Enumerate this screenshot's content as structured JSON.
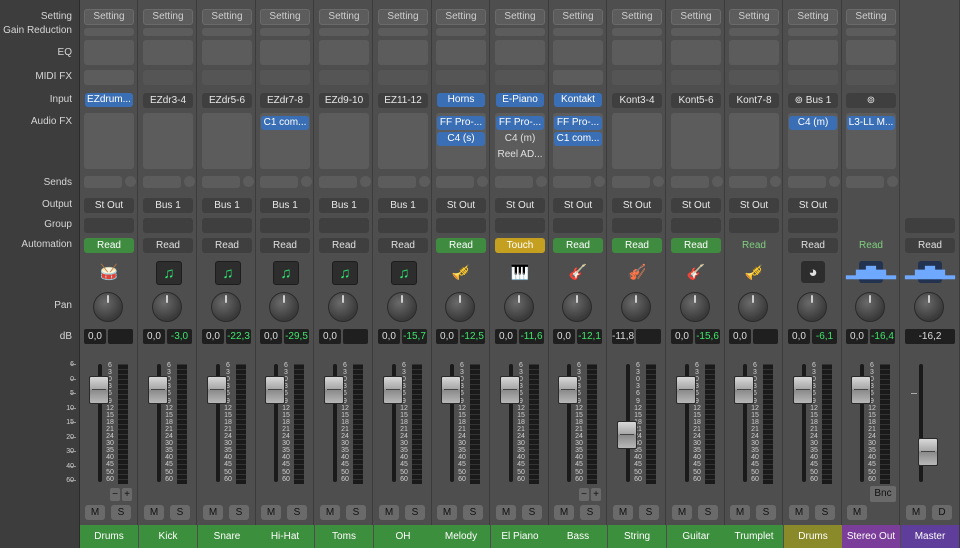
{
  "rows": {
    "setting": "Setting",
    "gain_reduction": "Gain Reduction",
    "eq": "EQ",
    "midi_fx": "MIDI FX",
    "input": "Input",
    "audio_fx": "Audio FX",
    "sends": "Sends",
    "output": "Output",
    "group": "Group",
    "automation": "Automation",
    "pan": "Pan",
    "db": "dB"
  },
  "setting_label": "Setting",
  "mute_label": "M",
  "solo_label": "S",
  "dim_label": "D",
  "minus_label": "−",
  "plus_label": "+",
  "bounce_label": "Bnc",
  "scale_ticks": [
    "6",
    "3",
    "0",
    "3",
    "6",
    "9",
    "12",
    "15",
    "18",
    "21",
    "24",
    "30",
    "35",
    "40",
    "45",
    "50",
    "60"
  ],
  "left_scale_ticks": [
    "6",
    "0",
    "5",
    "10",
    "15",
    "20",
    "30",
    "40",
    "60"
  ],
  "colors": {
    "plugin_blue": "#3a6fb6",
    "automation_read": "#3f8b3f",
    "automation_touch": "#c5a020",
    "peak_green": "#3de86a",
    "name_green": "#3c8f3c",
    "name_yellow": "#8a8a2a",
    "name_purple": "#7a3d9a"
  },
  "channels": [
    {
      "name": "Drums",
      "color": "green",
      "input": "EZdrum...",
      "input_hl": true,
      "fx": [],
      "output": "St Out",
      "automation": "Read",
      "auto_style": "read",
      "icon": "drum-kit-icon",
      "icon_glyph": "🥁",
      "icon_style": "plain",
      "pan": "0,0",
      "peak": "",
      "fader_db": 0,
      "plusminus": true
    },
    {
      "name": "Kick",
      "color": "green",
      "input": "EZdr3-4",
      "input_hl": false,
      "fx": [],
      "output": "Bus 1",
      "automation": "Read",
      "auto_style": "master",
      "icon": "midi-note-icon",
      "icon_glyph": "♫",
      "icon_style": "note",
      "pan": "0,0",
      "peak": "-3,0",
      "fader_db": 0
    },
    {
      "name": "Snare",
      "color": "green",
      "input": "EZdr5-6",
      "input_hl": false,
      "fx": [],
      "output": "Bus 1",
      "automation": "Read",
      "auto_style": "master",
      "icon": "midi-note-icon",
      "icon_glyph": "♫",
      "icon_style": "note",
      "pan": "0,0",
      "peak": "-22,3",
      "fader_db": 0
    },
    {
      "name": "Hi-Hat",
      "color": "green",
      "input": "EZdr7-8",
      "input_hl": false,
      "fx": [
        "C1 com..."
      ],
      "output": "Bus 1",
      "automation": "Read",
      "auto_style": "master",
      "icon": "midi-note-icon",
      "icon_glyph": "♫",
      "icon_style": "note",
      "pan": "0,0",
      "peak": "-29,5",
      "fader_db": 0
    },
    {
      "name": "Toms",
      "color": "green",
      "input": "EZd9-10",
      "input_hl": false,
      "fx": [],
      "output": "Bus 1",
      "automation": "Read",
      "auto_style": "master",
      "icon": "midi-note-icon",
      "icon_glyph": "♫",
      "icon_style": "note",
      "pan": "0,0",
      "peak": "",
      "fader_db": 0
    },
    {
      "name": "OH",
      "color": "green",
      "input": "EZ11-12",
      "input_hl": false,
      "fx": [],
      "output": "Bus 1",
      "automation": "Read",
      "auto_style": "master",
      "icon": "midi-note-icon",
      "icon_glyph": "♫",
      "icon_style": "note",
      "pan": "0,0",
      "peak": "-15,7",
      "fader_db": 0
    },
    {
      "name": "Melody",
      "color": "green",
      "input": "Horns",
      "input_hl": true,
      "fx": [
        "FF Pro-...",
        "C4 (s)"
      ],
      "output": "St Out",
      "automation": "Read",
      "auto_style": "read",
      "icon": "horns-icon",
      "icon_glyph": "🎺",
      "icon_style": "plain",
      "pan": "0,0",
      "peak": "-12,5",
      "fader_db": 0
    },
    {
      "name": "El Piano",
      "color": "green",
      "input": "E-Piano",
      "input_hl": true,
      "fx": [
        "FF Pro-...",
        "C4 (m)",
        "Reel AD..."
      ],
      "fx_plain": [
        false,
        true,
        true
      ],
      "output": "St Out",
      "automation": "Touch",
      "auto_style": "touch",
      "icon": "piano-icon",
      "icon_glyph": "🎹",
      "icon_style": "plain",
      "pan": "0,0",
      "peak": "-11,6",
      "fader_db": 0
    },
    {
      "name": "Bass",
      "color": "green",
      "input": "Kontakt",
      "input_hl": true,
      "fx": [
        "FF Pro-...",
        "C1 com..."
      ],
      "output": "St Out",
      "automation": "Read",
      "auto_style": "read",
      "icon": "bass-guitar-icon",
      "icon_glyph": "🎸",
      "icon_style": "plain",
      "pan": "0,0",
      "peak": "-12,1",
      "fader_db": 0,
      "plusminus": true
    },
    {
      "name": "String",
      "color": "green",
      "input": "Kont3-4",
      "input_hl": false,
      "fx": [],
      "output": "St Out",
      "automation": "Read",
      "auto_style": "read",
      "icon": "strings-icon",
      "icon_glyph": "🎻",
      "icon_style": "plain",
      "pan": "-11,8",
      "peak": "",
      "fader_db": -11.8,
      "wide_db": false
    },
    {
      "name": "Guitar",
      "color": "green",
      "input": "Kont5-6",
      "input_hl": false,
      "fx": [],
      "output": "St Out",
      "automation": "Read",
      "auto_style": "read",
      "icon": "acoustic-guitar-icon",
      "icon_glyph": "🎸",
      "icon_style": "plain",
      "pan": "0,0",
      "peak": "-15,6",
      "fader_db": 0
    },
    {
      "name": "Trumplet",
      "color": "green",
      "input": "Kont7-8",
      "input_hl": false,
      "fx": [],
      "output": "St Out",
      "automation": "Read",
      "auto_style": "stereo",
      "icon": "trumpet-icon",
      "icon_glyph": "🎺",
      "icon_style": "plain",
      "pan": "0,0",
      "peak": "",
      "fader_db": 0
    },
    {
      "name": "Drums",
      "color": "yellow",
      "input": "Bus 1",
      "input_link": true,
      "input_hl": false,
      "fx": [
        "C4 (m)"
      ],
      "output": "St Out",
      "automation": "Read",
      "auto_style": "master",
      "icon": "aux-clock-icon",
      "icon_glyph": "◕",
      "icon_style": "clock",
      "pan": "0,0",
      "peak": "-6,1",
      "fader_db": 0
    },
    {
      "name": "Stereo Out",
      "color": "purple",
      "input": "",
      "input_link": true,
      "input_hl": false,
      "fx": [
        "L3-LL M..."
      ],
      "output": "",
      "automation": "Read",
      "auto_style": "stereo",
      "icon": "waveform-icon",
      "icon_glyph": "▂▅▇▅▂",
      "icon_style": "wave",
      "pan": "0,0",
      "peak": "-16,4",
      "fader_db": 0,
      "bounce": true,
      "no_group": true
    },
    {
      "name": "Master",
      "color": "violet",
      "automation": "Read",
      "auto_style": "master",
      "icon": "waveform-icon",
      "icon_glyph": "▂▅▇▅▂",
      "icon_style": "wave",
      "db_value": "-16,2",
      "fader_db": -16.2,
      "master": true
    }
  ]
}
